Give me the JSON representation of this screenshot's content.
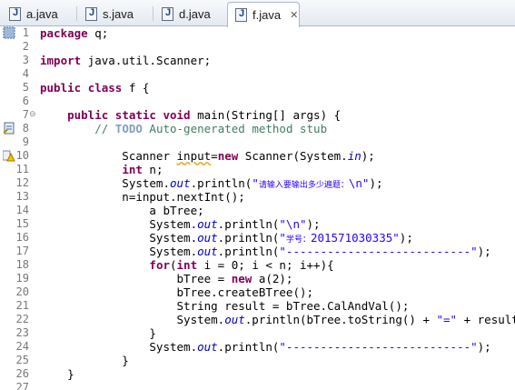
{
  "tabs": [
    {
      "label": "a.java",
      "active": false
    },
    {
      "label": "s.java",
      "active": false
    },
    {
      "label": "d.java",
      "active": false
    },
    {
      "label": "f.java",
      "active": true
    }
  ],
  "tab_close_glyph": "✕",
  "fold_glyph": "⊖",
  "lines": [
    {
      "n": "1",
      "tokens": [
        [
          "kw",
          "package"
        ],
        [
          "t",
          " q;"
        ]
      ]
    },
    {
      "n": "2",
      "tokens": []
    },
    {
      "n": "3",
      "tokens": [
        [
          "kw",
          "import"
        ],
        [
          "t",
          " java.util.Scanner;"
        ]
      ]
    },
    {
      "n": "4",
      "tokens": []
    },
    {
      "n": "5",
      "tokens": [
        [
          "kw",
          "public"
        ],
        [
          "t",
          " "
        ],
        [
          "kw",
          "class"
        ],
        [
          "t",
          " f {"
        ]
      ]
    },
    {
      "n": "6",
      "tokens": []
    },
    {
      "n": "7",
      "tokens": [
        [
          "t",
          "    "
        ],
        [
          "kw",
          "public"
        ],
        [
          "t",
          " "
        ],
        [
          "kw",
          "static"
        ],
        [
          "t",
          " "
        ],
        [
          "kw",
          "void"
        ],
        [
          "t",
          " main(String[] args) {"
        ]
      ]
    },
    {
      "n": "8",
      "tokens": [
        [
          "t",
          "        "
        ],
        [
          "com",
          "// "
        ],
        [
          "todo",
          "TODO"
        ],
        [
          "com",
          " Auto-generated method stub"
        ]
      ]
    },
    {
      "n": "9",
      "tokens": []
    },
    {
      "n": "10",
      "tokens": [
        [
          "t",
          "            Scanner "
        ],
        [
          "warn",
          "input"
        ],
        [
          "t",
          "="
        ],
        [
          "kw",
          "new"
        ],
        [
          "t",
          " Scanner(System."
        ],
        [
          "static",
          "in"
        ],
        [
          "t",
          ");"
        ]
      ]
    },
    {
      "n": "11",
      "tokens": [
        [
          "t",
          "            "
        ],
        [
          "kw",
          "int"
        ],
        [
          "t",
          " n;"
        ]
      ]
    },
    {
      "n": "12",
      "tokens": [
        [
          "t",
          "            System."
        ],
        [
          "static",
          "out"
        ],
        [
          "t",
          ".println("
        ],
        [
          "str",
          "\""
        ],
        [
          "cjk",
          "请输入要输出多少遍题："
        ],
        [
          "str",
          "\\n\""
        ],
        [
          "t",
          ");"
        ]
      ]
    },
    {
      "n": "13",
      "tokens": [
        [
          "t",
          "            n=input.nextInt();"
        ]
      ]
    },
    {
      "n": "14",
      "tokens": [
        [
          "t",
          "                a bTree;"
        ]
      ]
    },
    {
      "n": "15",
      "tokens": [
        [
          "t",
          "                System."
        ],
        [
          "static",
          "out"
        ],
        [
          "t",
          ".println("
        ],
        [
          "str",
          "\"\\n\""
        ],
        [
          "t",
          ");"
        ]
      ]
    },
    {
      "n": "16",
      "tokens": [
        [
          "t",
          "                System."
        ],
        [
          "static",
          "out"
        ],
        [
          "t",
          ".println("
        ],
        [
          "str",
          "\""
        ],
        [
          "cjk",
          "学号："
        ],
        [
          "str",
          "201571030335\""
        ],
        [
          "t",
          ");"
        ]
      ]
    },
    {
      "n": "17",
      "tokens": [
        [
          "t",
          "                System."
        ],
        [
          "static",
          "out"
        ],
        [
          "t",
          ".println("
        ],
        [
          "str",
          "\"---------------------------\""
        ],
        [
          "t",
          ");"
        ]
      ]
    },
    {
      "n": "18",
      "tokens": [
        [
          "t",
          "                "
        ],
        [
          "kw",
          "for"
        ],
        [
          "t",
          "("
        ],
        [
          "kw",
          "int"
        ],
        [
          "t",
          " i = 0; i < n; i++){"
        ]
      ]
    },
    {
      "n": "19",
      "tokens": [
        [
          "t",
          "                    bTree = "
        ],
        [
          "kw",
          "new"
        ],
        [
          "t",
          " a(2);"
        ]
      ]
    },
    {
      "n": "20",
      "tokens": [
        [
          "t",
          "                    bTree.createBTree();"
        ]
      ]
    },
    {
      "n": "21",
      "tokens": [
        [
          "t",
          "                    String result = bTree.CalAndVal();"
        ]
      ]
    },
    {
      "n": "22",
      "tokens": [
        [
          "t",
          "                    System."
        ],
        [
          "static",
          "out"
        ],
        [
          "t",
          ".println(bTree.toString() + "
        ],
        [
          "str",
          "\"=\""
        ],
        [
          "t",
          " + result);"
        ]
      ]
    },
    {
      "n": "23",
      "tokens": [
        [
          "t",
          "                }"
        ]
      ]
    },
    {
      "n": "24",
      "tokens": [
        [
          "t",
          "                System."
        ],
        [
          "static",
          "out"
        ],
        [
          "t",
          ".println("
        ],
        [
          "str",
          "\"---------------------------\""
        ],
        [
          "t",
          ");"
        ]
      ]
    },
    {
      "n": "25",
      "tokens": [
        [
          "t",
          "            }"
        ]
      ]
    },
    {
      "n": "26",
      "tokens": [
        [
          "t",
          "    }"
        ]
      ]
    },
    {
      "n": "27",
      "tokens": []
    }
  ],
  "colors": {
    "keyword": "#7f0055",
    "string": "#2a00ff",
    "comment": "#3f7f5f",
    "static_field": "#0000c0",
    "line_number": "#787878"
  },
  "gutter_icons": {
    "1": "bookmark-icon",
    "8": "task-marker-icon",
    "10": "warning-marker-icon"
  }
}
